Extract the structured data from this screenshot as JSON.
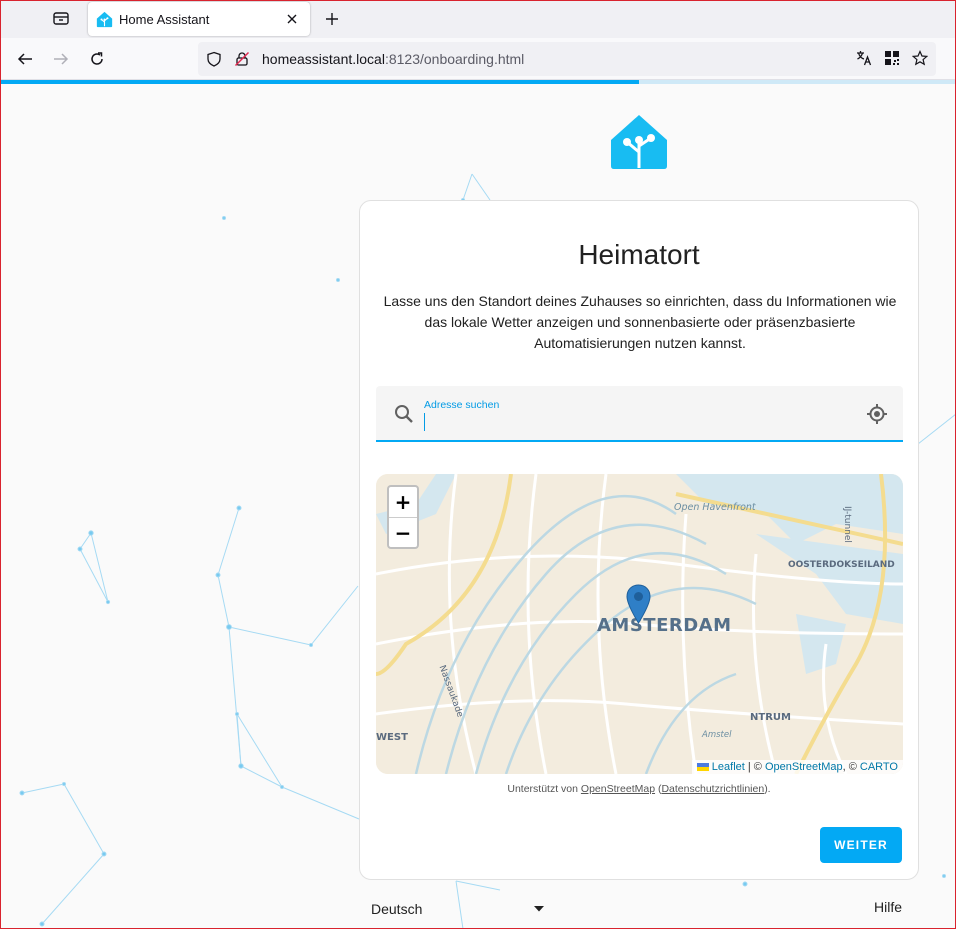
{
  "browser": {
    "tab_title": "Home Assistant",
    "url_host": "homeassistant.local",
    "url_rest": ":8123/onboarding.html",
    "page_load_progress": 0.668
  },
  "icons": {
    "tab_overview": "tab-overview-icon",
    "favicon": "home-assistant-icon",
    "close": "close-icon",
    "new_tab": "plus-icon",
    "back": "arrow-left-icon",
    "forward": "arrow-right-icon",
    "reload": "reload-icon",
    "shield": "shield-icon",
    "insecure": "insecure-lock-icon",
    "translate": "translate-icon",
    "qr": "qr-code-icon",
    "bookmark": "star-icon",
    "search": "search-icon",
    "locate": "crosshair-icon",
    "dropdown": "caret-down-icon"
  },
  "colors": {
    "accent": "#03a9f4",
    "label_accent": "#039be5",
    "frame": "#d9232e"
  },
  "page": {
    "title": "Heimatort",
    "description": "Lasse uns den Standort deines Zuhauses so einrichten, dass du Informationen wie das lokale Wetter anzeigen und sonnenbasierte oder präsenzbasierte Automatisierungen nutzen kannst.",
    "search_label": "Adresse suchen",
    "search_value": "",
    "map": {
      "zoom_in": "+",
      "zoom_out": "−",
      "labels": {
        "city": "AMSTERDAM",
        "open_havenfront": "Open Havenfront",
        "oosterdokseiland": "OOSTERDOKSEILAND",
        "ij_tunnel": "IJ-tunnel",
        "nassaukade": "Nassaukade",
        "west": "WEST",
        "centrum": "NTRUM",
        "amstel": "Amstel"
      },
      "attribution": {
        "leaflet": "Leaflet",
        "sep1": " | © ",
        "osm": "OpenStreetMap",
        "sep2": ", © ",
        "carto": "CARTO"
      }
    },
    "credit_prefix": "Unterstützt von ",
    "credit_osm": "OpenStreetMap",
    "credit_mid": " (",
    "credit_privacy": "Datenschutzrichtlinien",
    "credit_suffix": ").",
    "next_button": "WEITER",
    "language": "Deutsch",
    "help": "Hilfe"
  }
}
